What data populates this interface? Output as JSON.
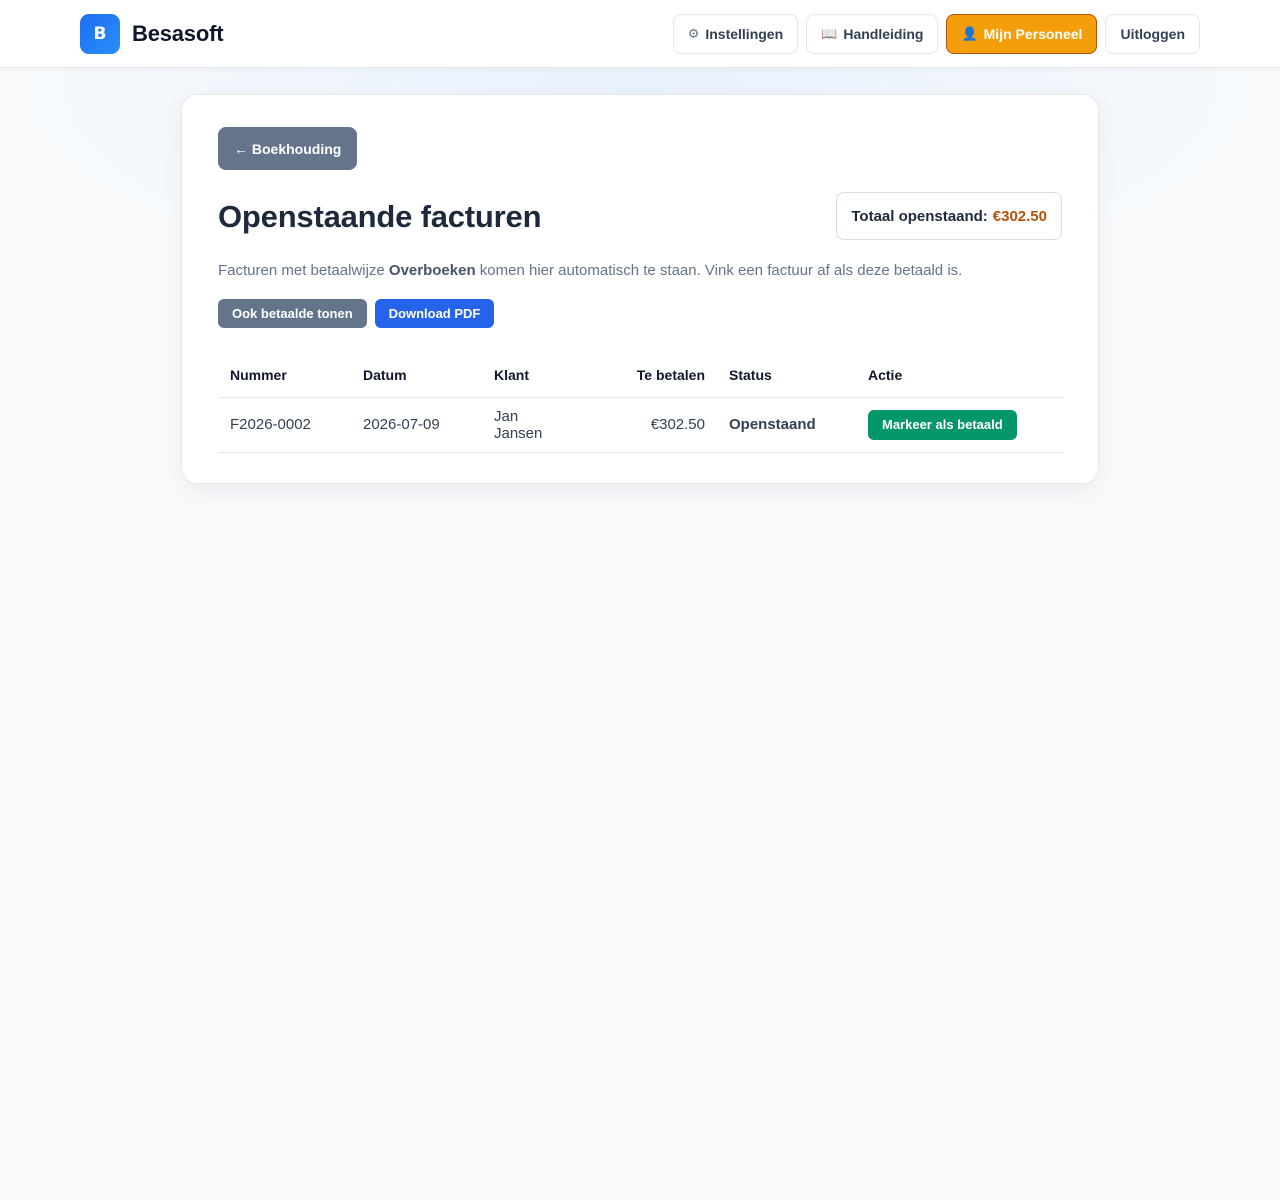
{
  "header": {
    "logo_letter": "B",
    "brand": "Besasoft",
    "nav": {
      "settings": {
        "icon": "⚙",
        "label": "Instellingen"
      },
      "manual": {
        "icon": "📖",
        "label": "Handleiding"
      },
      "staff": {
        "icon": "👤",
        "label": "Mijn Personeel"
      },
      "logout": {
        "label": "Uitloggen"
      }
    }
  },
  "page": {
    "back_label": "← Boekhouding",
    "title": "Openstaande facturen",
    "total_label": "Totaal openstaand:",
    "total_amount": "€302.50",
    "intro_before": "Facturen met betaalwijze ",
    "intro_bold": "Overboeken",
    "intro_after": " komen hier automatisch te staan. Vink een factuur af als deze betaald is.",
    "show_paid_label": "Ook betaalde tonen",
    "download_label": "Download PDF"
  },
  "table": {
    "headers": {
      "number": "Nummer",
      "date": "Datum",
      "client": "Klant",
      "amount": "Te betalen",
      "status": "Status",
      "action": "Actie"
    },
    "rows": [
      {
        "number": "F2026-0002",
        "date": "2026-07-09",
        "client": "Jan Jansen",
        "amount": "€302.50",
        "status": "Openstaand",
        "action": "Markeer als betaald"
      }
    ]
  },
  "colors": {
    "brand_blue": "#1d6df2",
    "accent_orange": "#f59e0b",
    "status_open": "#b45309",
    "success_green": "#059669",
    "primary_blue": "#2563eb",
    "slate": "#64748b"
  }
}
